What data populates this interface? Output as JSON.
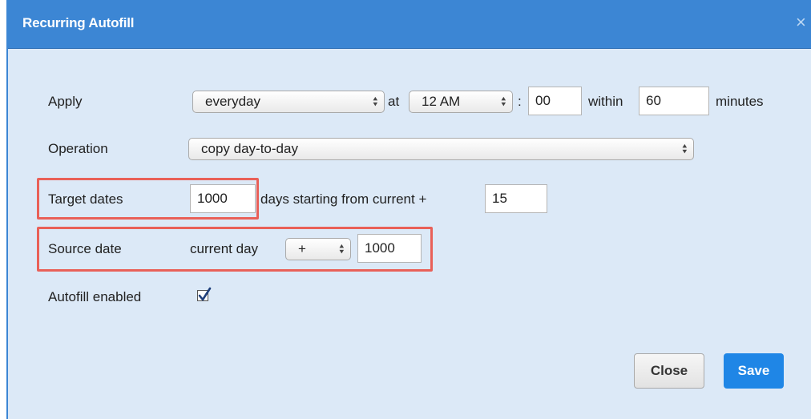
{
  "dialog": {
    "title": "Recurring Autofill",
    "close_icon": "×"
  },
  "apply": {
    "label": "Apply",
    "frequency": "everyday",
    "at_label": "at",
    "hour": "12 AM",
    "colon": ":",
    "minute": "00",
    "within_label": "within",
    "within_value": "60",
    "minutes_label": "minutes"
  },
  "operation": {
    "label": "Operation",
    "value": "copy day-to-day"
  },
  "target": {
    "label": "Target dates",
    "days": "1000",
    "days_text": "days starting from current +",
    "offset": "15"
  },
  "source": {
    "label": "Source date",
    "current_day_text": "current day",
    "sign": "+",
    "value": "1000"
  },
  "autofill": {
    "label": "Autofill enabled",
    "checked": true
  },
  "buttons": {
    "close": "Close",
    "save": "Save"
  },
  "colors": {
    "titlebar": "#3c86d4",
    "dialog_bg": "#dce9f7",
    "highlight": "#e96058",
    "save_button": "#1f86e6"
  },
  "icons": {
    "select_arrows": "updown-arrows-icon",
    "checkmark": "checkmark-icon"
  }
}
